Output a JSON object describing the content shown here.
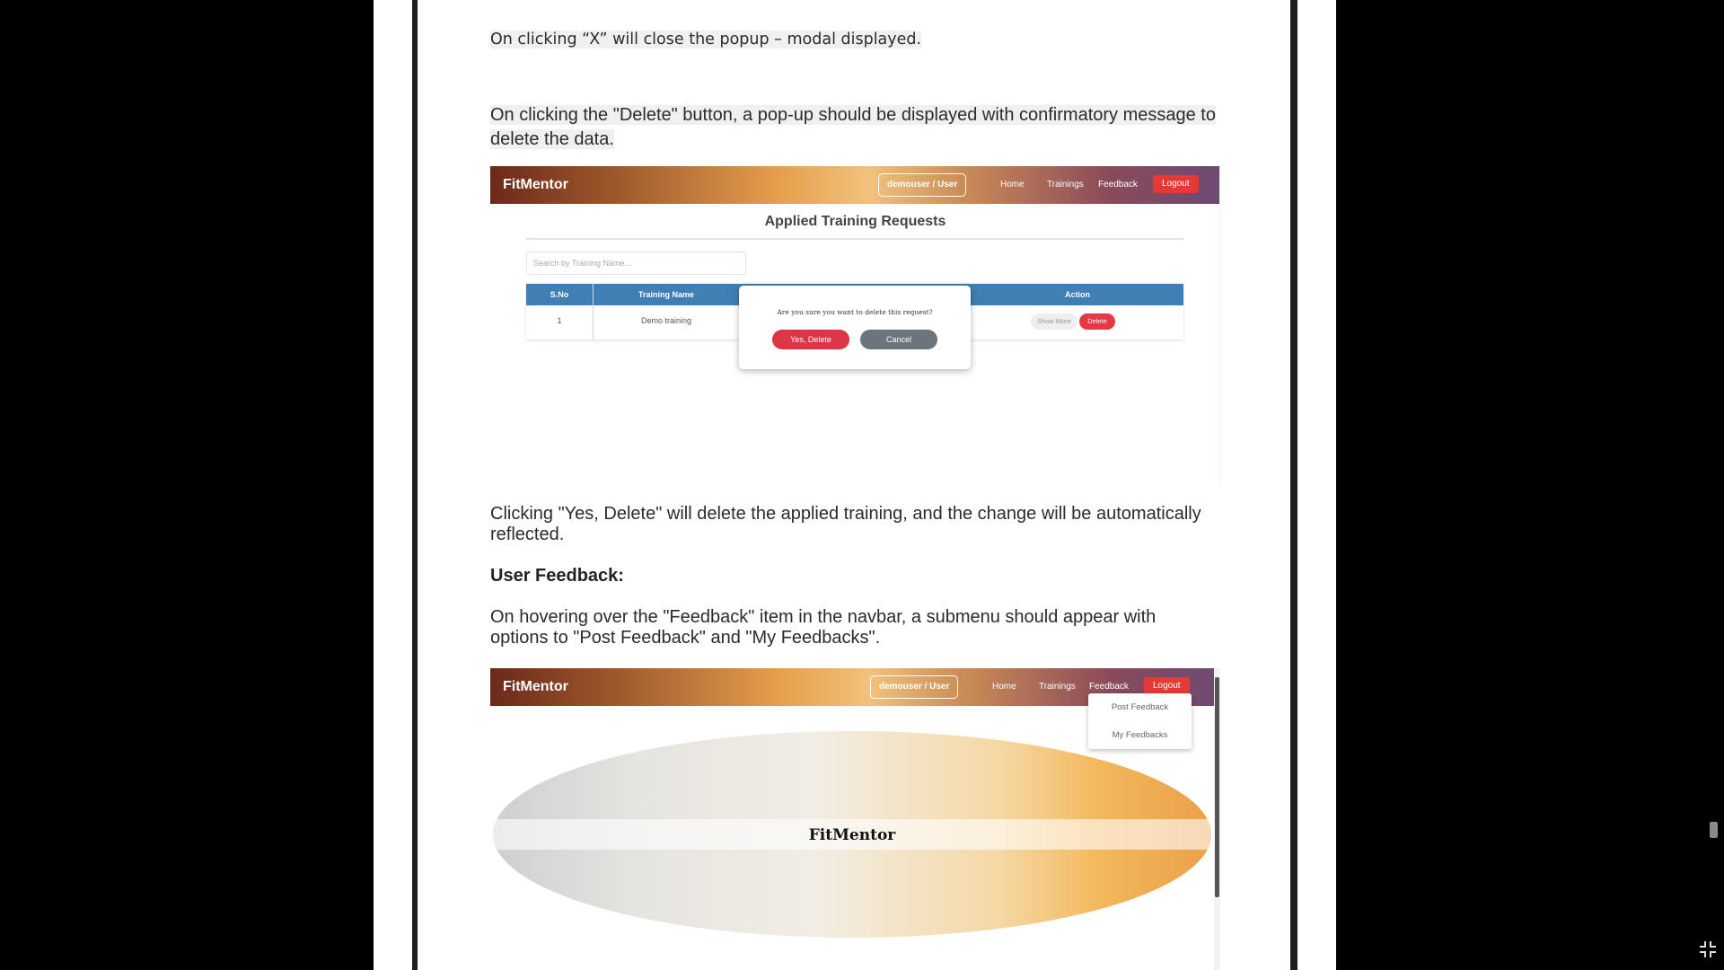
{
  "document": {
    "p1": "On clicking “X” will close the popup – modal displayed.",
    "p2": "On clicking the \"Delete\" button, a pop-up should be displayed with confirmatory message to delete the data.",
    "p3": "Clicking \"Yes, Delete\" will delete the applied training, and the change will be automatically reflected.",
    "heading_feedback": "User Feedback:",
    "p4": "On hovering over the \"Feedback\" item in the navbar, a submenu should appear with options to \"Post Feedback\" and \"My Feedbacks\"."
  },
  "screenshot1": {
    "brand": "FitMentor",
    "user": "demouser / User",
    "nav": {
      "home": "Home",
      "trainings": "Trainings",
      "feedback": "Feedback",
      "logout": "Logout"
    },
    "title": "Applied Training Requests",
    "search_placeholder": "Search by Training Name...",
    "table": {
      "headers": {
        "sno": "S.No",
        "name": "Training Name",
        "action": "Action"
      },
      "row": {
        "sno": "1",
        "name": "Demo training",
        "show_more": "Show More",
        "delete": "Delete"
      }
    },
    "modal": {
      "message": "Are you sure you want to delete this request?",
      "yes": "Yes, Delete",
      "cancel": "Cancel"
    }
  },
  "screenshot2": {
    "brand": "FitMentor",
    "user": "demouser / User",
    "nav": {
      "home": "Home",
      "trainings": "Trainings",
      "feedback": "Feedback",
      "logout": "Logout"
    },
    "dropdown": {
      "post": "Post Feedback",
      "mine": "My Feedbacks"
    },
    "hero_title": "FitMentor"
  },
  "colors": {
    "logout": "#e53935",
    "table_header": "#3f7fb3",
    "confirm": "#dc3545",
    "cancel": "#6c757d"
  },
  "icons": {
    "exit_fullscreen": "exit-fullscreen-icon"
  }
}
